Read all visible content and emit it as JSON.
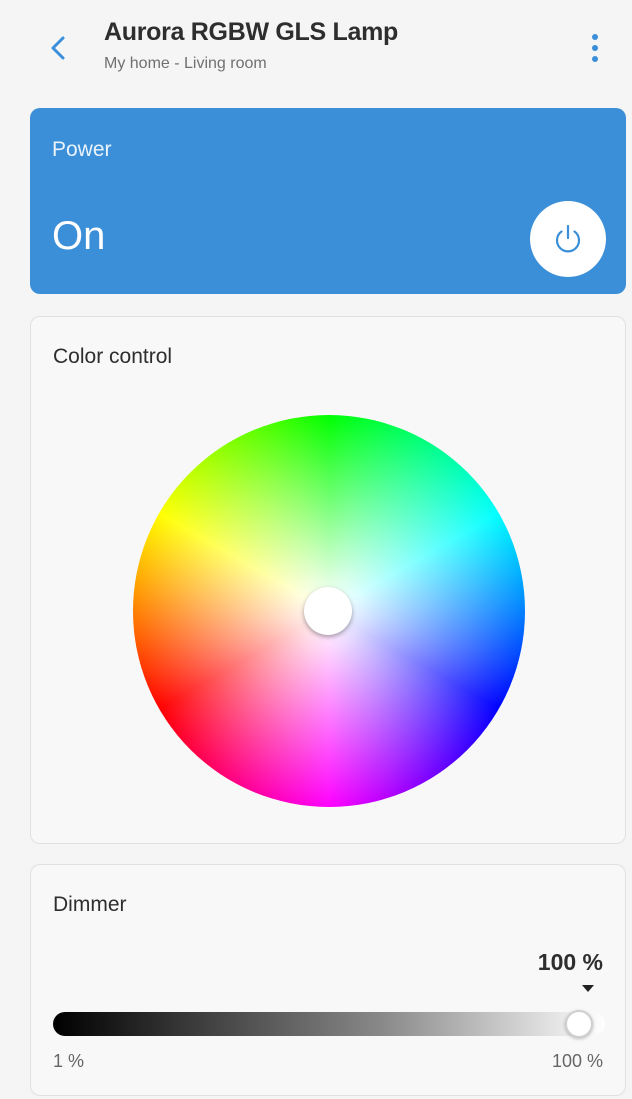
{
  "header": {
    "title": "Aurora RGBW GLS Lamp",
    "subtitle": "My home - Living room",
    "back_icon": "chevron-left-icon",
    "more_icon": "more-vertical-icon",
    "accent_color": "#3a8fd8"
  },
  "power": {
    "label": "Power",
    "state": "On",
    "button_icon": "power-icon",
    "card_color": "#3b8fd8"
  },
  "color_control": {
    "heading": "Color control",
    "selected_color": "#ffffff"
  },
  "dimmer": {
    "heading": "Dimmer",
    "value": "100 %",
    "level_percent": 100,
    "min_label": "1 %",
    "max_label": "100 %"
  }
}
